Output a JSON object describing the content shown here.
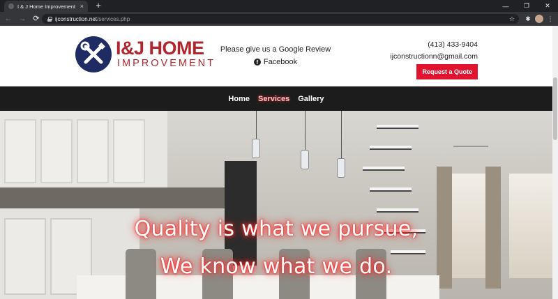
{
  "browser": {
    "tab_title": "I & J Home Improvement",
    "tab_close": "×",
    "new_tab": "+",
    "window_controls": [
      "—",
      "❐",
      "✕"
    ],
    "nav_back": "←",
    "nav_forward": "→",
    "nav_reload": "⟳",
    "url_host": "ijconstruction.net",
    "url_path": "/services.php",
    "bookmark_icon": "☆",
    "extensions_icon": "✱",
    "menu_icon": "⋮"
  },
  "header": {
    "logo_main": "I&J HOME",
    "logo_sub": "IMPROVEMENT",
    "review_text": "Please give us a Google Review",
    "facebook_label": "Facebook",
    "facebook_glyph": "f",
    "phone": "(413) 433-9404",
    "email": "ijconstructionn@gmail.com",
    "quote_button": "Request a Quote"
  },
  "nav": {
    "items": [
      {
        "label": "Home",
        "active": false
      },
      {
        "label": "Services",
        "active": true
      },
      {
        "label": "Gallery",
        "active": false
      }
    ]
  },
  "hero": {
    "line1": "Quality is what we pursue,",
    "line2": "We know what we do."
  },
  "colors": {
    "brand_red": "#e0142f",
    "logo_navy": "#1f2b63",
    "nav_bg": "#1c1c1c"
  }
}
